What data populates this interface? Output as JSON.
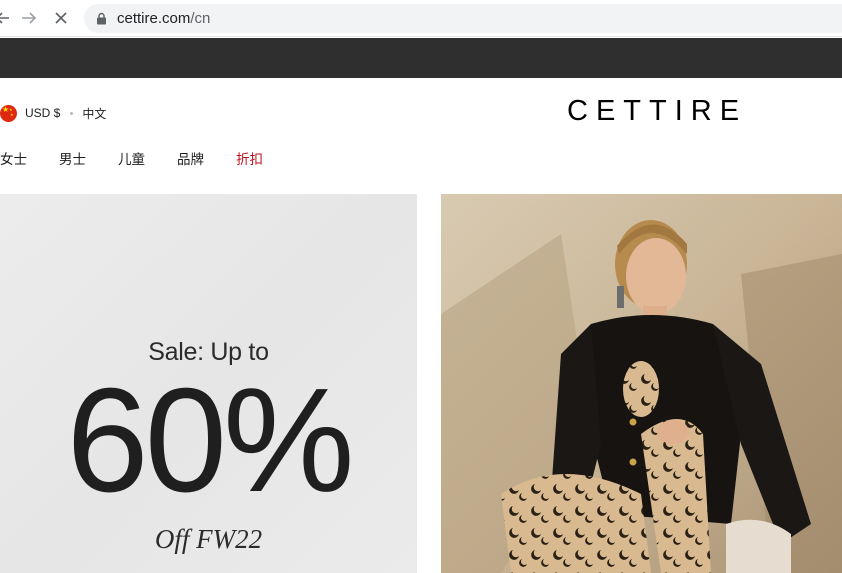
{
  "browser": {
    "url_domain": "cettire.com",
    "url_path": "/cn"
  },
  "header": {
    "currency": "USD $",
    "language": "中文",
    "logo": "CETTIRE"
  },
  "nav": {
    "items": [
      {
        "label": "女士"
      },
      {
        "label": "男士"
      },
      {
        "label": "儿童"
      },
      {
        "label": "品牌"
      },
      {
        "label": "折扣"
      }
    ]
  },
  "hero": {
    "kicker": "Sale: Up to",
    "percent": "60%",
    "season": "Off FW22"
  },
  "colors": {
    "promo_strip": "#2f2f2f",
    "sale_accent": "#c1121f",
    "hero_bg": "#e9e9e9"
  },
  "icons": [
    "back-arrow-icon",
    "forward-arrow-icon",
    "stop-loading-icon",
    "lock-icon",
    "china-flag-icon"
  ]
}
